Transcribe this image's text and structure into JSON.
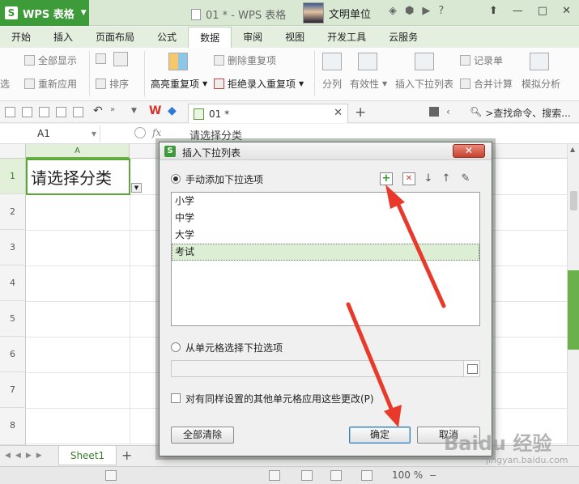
{
  "app": {
    "name": "WPS 表格",
    "doc_title": "01 * - WPS 表格",
    "user": "文明单位"
  },
  "window_controls": {
    "minimize": "—",
    "maximize": "□",
    "close": "✕"
  },
  "menu": {
    "tabs": [
      "开始",
      "插入",
      "页面布局",
      "公式",
      "数据",
      "审阅",
      "视图",
      "开发工具",
      "云服务"
    ],
    "active": "数据"
  },
  "ribbon": {
    "filter_show_all": "全部显示",
    "filter_reapply": "重新应用",
    "filter_select": "选",
    "sort": "排序",
    "highlight_dup": "高亮重复项",
    "remove_dup": "删除重复项",
    "reject_dup": "拒绝录入重复项",
    "split": "分列",
    "validity": "有效性",
    "insert_dropdown": "插入下拉列表",
    "record": "记录单",
    "merge_calc": "合并计算",
    "simulate": "模拟分析"
  },
  "quickbar": {
    "doc_tab": "01 *",
    "search_cmd": ">查找命令、搜索..."
  },
  "formula_bar": {
    "name_box": "A1",
    "fx": "fx",
    "value": "请选择分类"
  },
  "sheet": {
    "col_a": "A",
    "rows": [
      "1",
      "2",
      "3",
      "4",
      "5",
      "6",
      "7",
      "8"
    ],
    "a1_value": "请选择分类",
    "tab": "Sheet1",
    "add": "+"
  },
  "status": {
    "zoom": "100 %"
  },
  "dialog": {
    "title": "插入下拉列表",
    "close": "✕",
    "manual_option": "手动添加下拉选项",
    "items": [
      "小学",
      "中学",
      "大学",
      "考试"
    ],
    "selected_index": 3,
    "from_cells_option": "从单元格选择下拉选项",
    "apply_same_label": "对有同样设置的其他单元格应用这些更改(P)",
    "clear_all": "全部清除",
    "ok": "确定",
    "cancel": "取消"
  },
  "watermark": {
    "main": "Baidu 经验",
    "sub": "jingyan.baidu.com"
  },
  "colors": {
    "accent": "#3e9b3a",
    "arrow": "#e8392b"
  }
}
